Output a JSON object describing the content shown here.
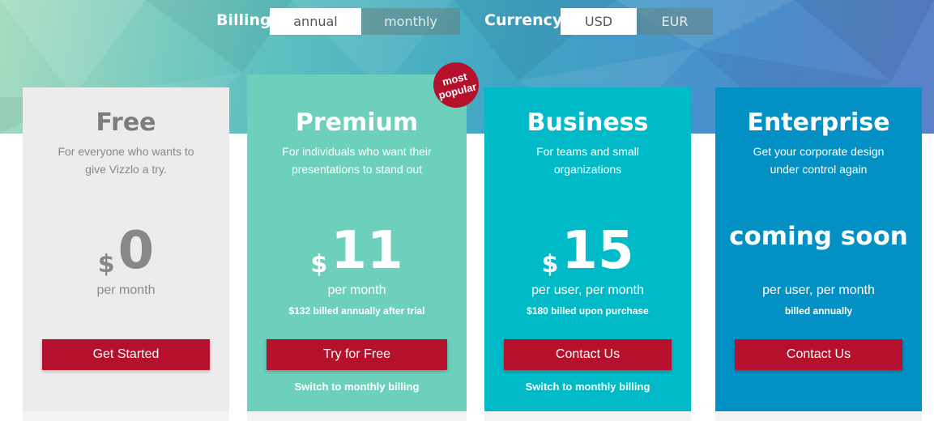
{
  "billing": {
    "label": "Billing",
    "options": [
      "annual",
      "monthly"
    ],
    "selected": "annual"
  },
  "currency": {
    "label": "Currency",
    "options": [
      "USD",
      "EUR"
    ],
    "selected": "USD"
  },
  "badge": {
    "line1": "most",
    "line2": "popular"
  },
  "plans": [
    {
      "title": "Free",
      "description": "For everyone who wants to give Vizzlo a try.",
      "currency": "$",
      "price": "0",
      "period": "per month",
      "billed": "",
      "button": "Get Started",
      "switch": ""
    },
    {
      "title": "Premium",
      "description": "For individuals who want their presentations to stand out",
      "currency": "$",
      "price": "11",
      "period": "per month",
      "billed": "$132 billed annually after trial",
      "button": "Try for Free",
      "switch": "Switch to monthly billing"
    },
    {
      "title": "Business",
      "description": "For teams and small organizations",
      "currency": "$",
      "price": "15",
      "period": "per user, per month",
      "billed": "$180 billed upon purchase",
      "button": "Contact Us",
      "switch": "Switch to monthly billing"
    },
    {
      "title": "Enterprise",
      "description": "Get your corporate design under control again",
      "coming": "coming soon",
      "period": "per user, per month",
      "billed": "billed annually",
      "button": "Contact Us",
      "switch": ""
    }
  ],
  "colors": {
    "button": "#b5112d",
    "free_card": "#ececec",
    "premium_card": "#6dd0bc",
    "business_card": "#00bac7",
    "enterprise_card": "#0391c5"
  }
}
